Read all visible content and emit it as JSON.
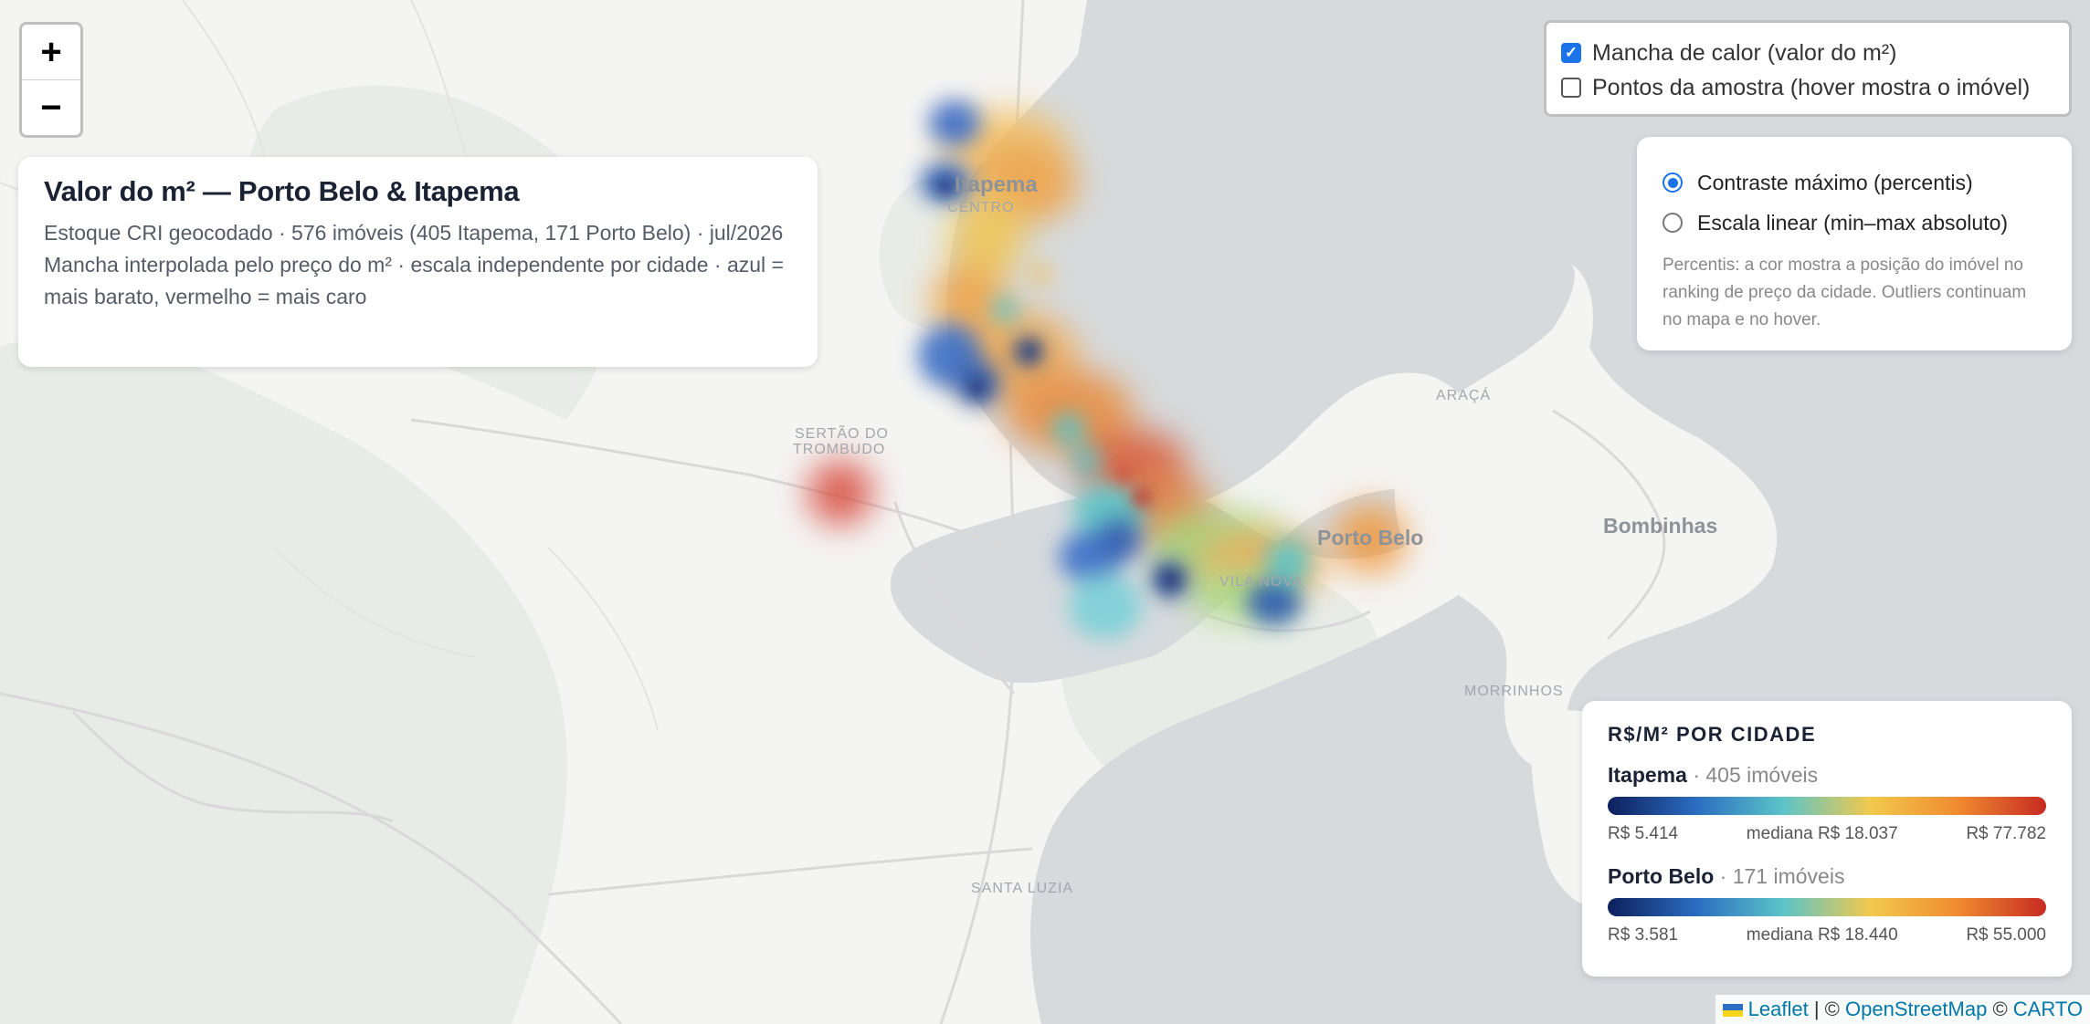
{
  "map": {
    "zoom_in": "+",
    "zoom_out": "−",
    "place_labels": {
      "itapema": "Itapema",
      "centro": "CENTRO",
      "sertao_line1": "SERTÃO DO",
      "sertao_line2": "TROMBUDO",
      "araca": "ARAÇÁ",
      "porto_belo": "Porto Belo",
      "bombinhas": "Bombinhas",
      "vila_nova": "VILA NOVA",
      "morrinhos": "MORRINHOS",
      "santa_luzia": "SANTA LUZIA"
    }
  },
  "title_panel": {
    "title": "Valor do m² — Porto Belo & Itapema",
    "line1": "Estoque CRI geocodado · 576 imóveis (405 Itapema, 171 Porto Belo) · jul/2026",
    "line2": "Mancha interpolada pelo preço do m² · escala independente por cidade · azul = mais barato, vermelho = mais caro"
  },
  "layers": {
    "heatmap_label": "Mancha de calor (valor do m²)",
    "heatmap_checked": true,
    "points_label": "Pontos da amostra (hover mostra o imóvel)",
    "points_checked": false
  },
  "scale_mode": {
    "option1": "Contraste máximo (percentis)",
    "option2": "Escala linear (min–max absoluto)",
    "selected": "option1",
    "note": "Percentis: a cor mostra a posição do imóvel no ranking de preço da cidade. Outliers continuam no mapa e no hover."
  },
  "legend": {
    "title": "R$/M² POR CIDADE",
    "cities": [
      {
        "name": "Itapema",
        "count": "· 405 imóveis",
        "min": "R$ 5.414",
        "median": "mediana R$ 18.037",
        "max": "R$ 77.782"
      },
      {
        "name": "Porto Belo",
        "count": "· 171 imóveis",
        "min": "R$ 3.581",
        "median": "mediana R$ 18.440",
        "max": "R$ 55.000"
      }
    ],
    "gradient": [
      "#0d1f5c",
      "#2b6cc0",
      "#5bc4c8",
      "#f2c94c",
      "#f08a30",
      "#c62a22"
    ]
  },
  "attribution": {
    "leaflet": "Leaflet",
    "sep1": "| ©",
    "osm": "OpenStreetMap",
    "sep2": "©",
    "carto": "CARTO"
  },
  "colors": {
    "water": "#d6dadd",
    "land": "#f4f4f3",
    "accent": "#1a73e8"
  }
}
